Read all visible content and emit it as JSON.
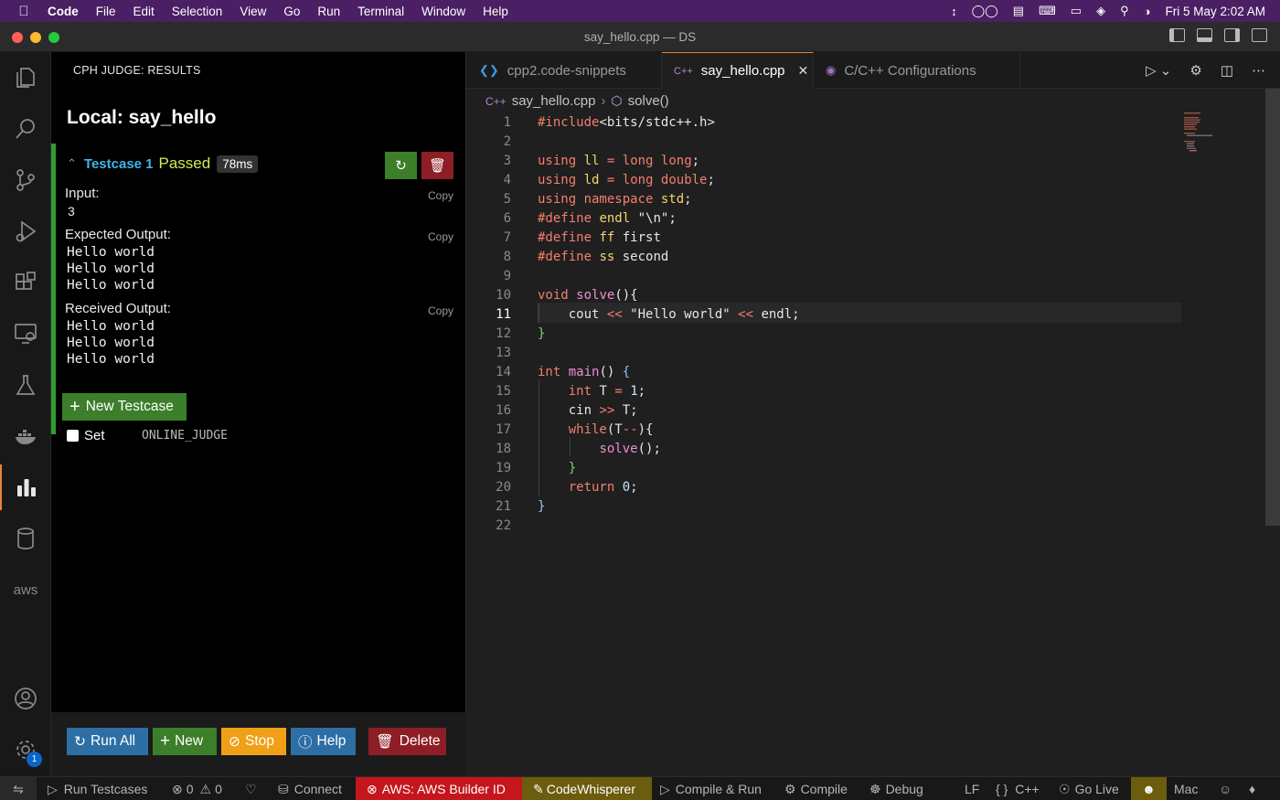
{
  "menubar": {
    "app": "Code",
    "items": [
      "File",
      "Edit",
      "Selection",
      "View",
      "Go",
      "Run",
      "Terminal",
      "Window",
      "Help"
    ],
    "datetime": "Fri 5 May  2:02 AM"
  },
  "window": {
    "title": "say_hello.cpp — DS"
  },
  "cph": {
    "header": "CPH JUDGE: RESULTS",
    "title": "Local: say_hello",
    "testcase": {
      "name": "Testcase 1",
      "status": "Passed",
      "time": "78ms",
      "input_label": "Input:",
      "input": "3",
      "expected_label": "Expected Output:",
      "expected": [
        "Hello world",
        "Hello world",
        "Hello world"
      ],
      "received_label": "Received Output:",
      "received": [
        "Hello world",
        "Hello world",
        "Hello world"
      ],
      "copy": "Copy"
    },
    "new_testcase": "New Testcase",
    "online_judge_prefix": "Set",
    "online_judge_code": "ONLINE_JUDGE",
    "footer": {
      "run_all": "Run All",
      "new": "New",
      "stop": "Stop",
      "help": "Help",
      "delete": "Delete"
    },
    "colors": {
      "passed_border": "#2f9e2f",
      "run_all": "#2d6ea4",
      "new": "#3c7e2a",
      "stop": "#f0a017",
      "help": "#2d6ea4",
      "delete": "#8e1e25"
    }
  },
  "tabs": [
    {
      "label": "cpp2.code-snippets",
      "active": false
    },
    {
      "label": "say_hello.cpp",
      "active": true
    },
    {
      "label": "C/C++ Configurations",
      "active": false
    }
  ],
  "breadcrumb": {
    "file": "say_hello.cpp",
    "symbol": "solve()"
  },
  "editor": {
    "current_line": 11,
    "line_numbers": [
      "1",
      "2",
      "3",
      "4",
      "5",
      "6",
      "7",
      "8",
      "9",
      "10",
      "11",
      "12",
      "13",
      "14",
      "15",
      "16",
      "17",
      "18",
      "19",
      "20",
      "21",
      "22"
    ]
  },
  "statusbar": {
    "run_testcases": "Run Testcases",
    "errors": "0",
    "warnings": "0",
    "connect": "Connect",
    "aws": "AWS: AWS Builder ID",
    "codewhisperer": "CodeWhisperer",
    "compile_run": "Compile & Run",
    "compile": "Compile",
    "debug": "Debug",
    "eol": "LF",
    "language": "C++",
    "golive": "Go Live",
    "platform": "Mac"
  }
}
